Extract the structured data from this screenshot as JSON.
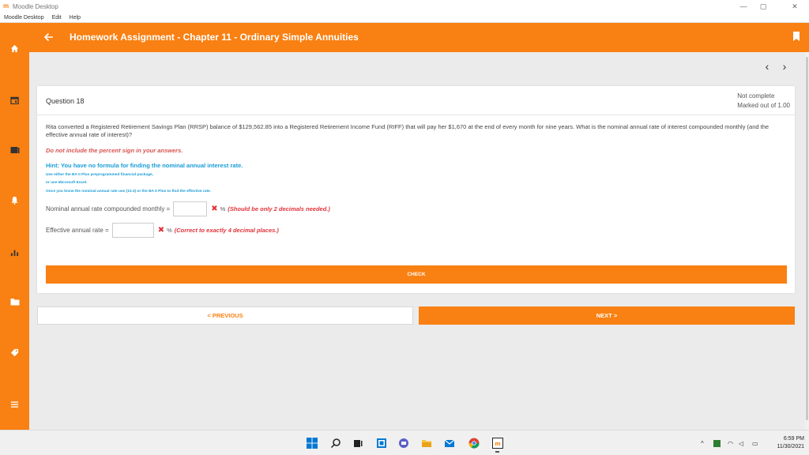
{
  "window": {
    "app_title": "Moodle Desktop",
    "menus": [
      "Moodle Desktop",
      "Edit",
      "Help"
    ]
  },
  "header": {
    "title": "Homework Assignment - Chapter 11 - Ordinary Simple Annuities"
  },
  "question": {
    "number_label": "Question 18",
    "status": "Not complete",
    "marks": "Marked out of 1.00",
    "text": "Rita converted a Registered Retirement Savings Plan (RRSP) balance of $129,562.85 into a Registered Retirement Income Fund (RIFF) that will pay her $1,670 at the end of every month for nine years. What is the nominal annual rate of interest compounded monthly (and the effective annual rate of interest)?",
    "instruction": "Do not include the percent sign in your answers.",
    "hint": "Hint: You have no formula for finding the nominal annual interest rate.",
    "hint_lines": [
      "Use either the BA II Plus preprogrammed financial package,",
      "or use Microsoft Excel.",
      "Once you know the nominal annual rate use (10.3) or the BA II Plus to find the effective rate."
    ],
    "fields": [
      {
        "label": "Nominal annual rate compounded monthly =",
        "value": "",
        "unit": "%",
        "feedback": "(Should be only 2 decimals needed.)"
      },
      {
        "label": "Effective annual rate =",
        "value": "",
        "unit": "%",
        "feedback": "(Correct to exactly 4 decimal places.)"
      }
    ],
    "check_label": "CHECK"
  },
  "nav": {
    "previous_label": "< PREVIOUS",
    "next_label": "NEXT >"
  },
  "taskbar": {
    "time": "6:59 PM",
    "date": "11/30/2021"
  },
  "colors": {
    "brand": "#f98012",
    "hint": "#1a9cd8",
    "error": "#e0333a"
  }
}
